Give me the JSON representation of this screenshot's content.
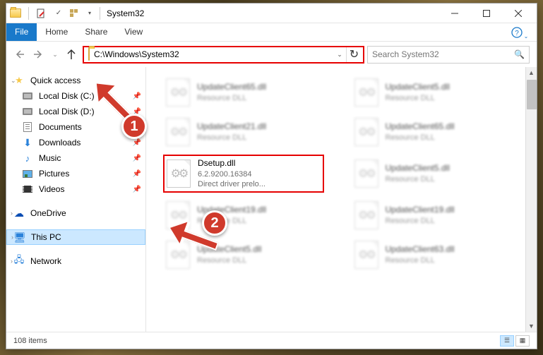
{
  "title": "System32",
  "ribbon": {
    "file": "File",
    "home": "Home",
    "share": "Share",
    "view": "View"
  },
  "nav": {
    "path": "C:\\Windows\\System32",
    "refresh_glyph": "↻",
    "search_placeholder": "Search System32"
  },
  "sidebar": {
    "quick": {
      "label": "Quick access",
      "items": [
        {
          "label": "Local Disk (C:)"
        },
        {
          "label": "Local Disk (D:)"
        },
        {
          "label": "Documents"
        },
        {
          "label": "Downloads"
        },
        {
          "label": "Music"
        },
        {
          "label": "Pictures"
        },
        {
          "label": "Videos"
        }
      ]
    },
    "onedrive": "OneDrive",
    "thispc": "This PC",
    "network": "Network"
  },
  "files": {
    "blurred": {
      "a": {
        "name": "UpdateClient65.dll",
        "sub": "Resource DLL"
      },
      "b": {
        "name": "UpdateClient5.dll",
        "sub": "Resource DLL"
      },
      "c": {
        "name": "UpdateClient21.dll",
        "sub": "Resource DLL"
      },
      "d": {
        "name": "UpdateClient65.dll",
        "sub": "Resource DLL"
      },
      "e": {
        "name": "UpdateClient5.dll",
        "sub": "Resource DLL"
      },
      "f": {
        "name": "UpdateClient19.dll",
        "sub": "Resource DLL"
      },
      "g": {
        "name": "UpdateClient19.dll",
        "sub": "Resource DLL"
      },
      "h": {
        "name": "UpdateClient5.dll",
        "sub": "Resource DLL"
      },
      "i": {
        "name": "UpdateClient63.dll",
        "sub": "Resource DLL"
      }
    },
    "highlighted": {
      "name": "Dsetup.dll",
      "version": "6.2.9200.16384",
      "desc": "Direct driver prelo..."
    }
  },
  "status": {
    "count": "108 items"
  },
  "markers": {
    "m1": "1",
    "m2": "2"
  }
}
